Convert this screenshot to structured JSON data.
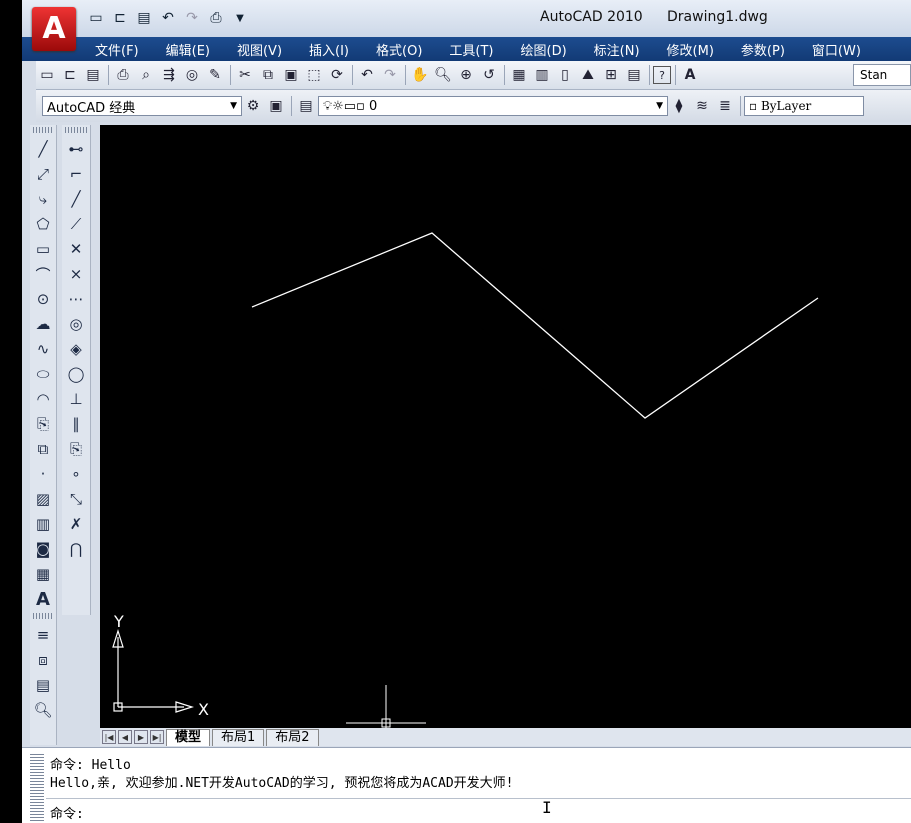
{
  "title": {
    "app": "AutoCAD 2010",
    "document": "Drawing1.dwg",
    "app_button": "A"
  },
  "menu": [
    "文件(F)",
    "编辑(E)",
    "视图(V)",
    "插入(I)",
    "格式(O)",
    "工具(T)",
    "绘图(D)",
    "标注(N)",
    "修改(M)",
    "参数(P)",
    "窗口(W)"
  ],
  "toolbar": {
    "workspace": "AutoCAD 经典",
    "layer": "0",
    "color": "ByLayer",
    "text_style": "Stan"
  },
  "ucs": {
    "x_label": "X",
    "y_label": "Y"
  },
  "layout_tabs": [
    "模型",
    "布局1",
    "布局2"
  ],
  "command": {
    "line1": "命令: Hello",
    "line2": "Hello,亲, 欢迎参加.NET开发AutoCAD的学习, 预祝您将成为ACAD开发大师!",
    "prompt": "命令:"
  },
  "polyline_points": [
    [
      252,
      307
    ],
    [
      432,
      233
    ],
    [
      645,
      418
    ],
    [
      818,
      298
    ]
  ]
}
